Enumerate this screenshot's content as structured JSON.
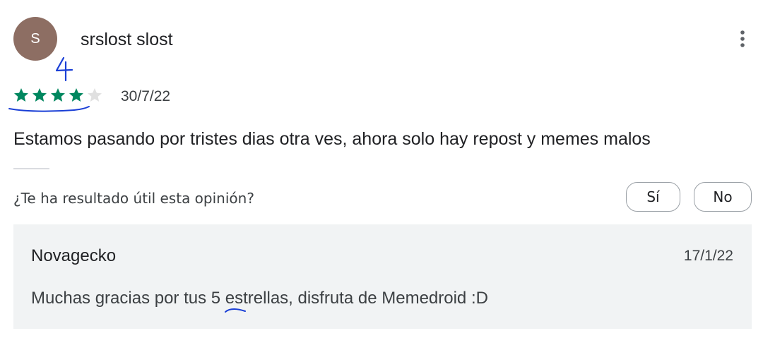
{
  "review": {
    "avatar_initial": "S",
    "avatar_color": "#8d6e63",
    "author": "srslost slost",
    "more_icon": "more-vert-icon",
    "rating": 4,
    "rating_max": 5,
    "star_color": "#01875f",
    "star_empty_color": "#e0e0e0",
    "date": "30/7/22",
    "text": "Estamos pasando por tristes dias otra ves, ahora solo hay repost y memes malos",
    "handwritten_note": "4",
    "annotation_color": "#1a3fd6"
  },
  "helpful": {
    "question": "¿Te ha resultado útil esta opinión?",
    "yes_label": "Sí",
    "no_label": "No"
  },
  "reply": {
    "author": "Novagecko",
    "date": "17/1/22",
    "text": "Muchas gracias por tus 5 estrellas, disfruta de Memedroid :D",
    "background": "#f1f3f4"
  }
}
